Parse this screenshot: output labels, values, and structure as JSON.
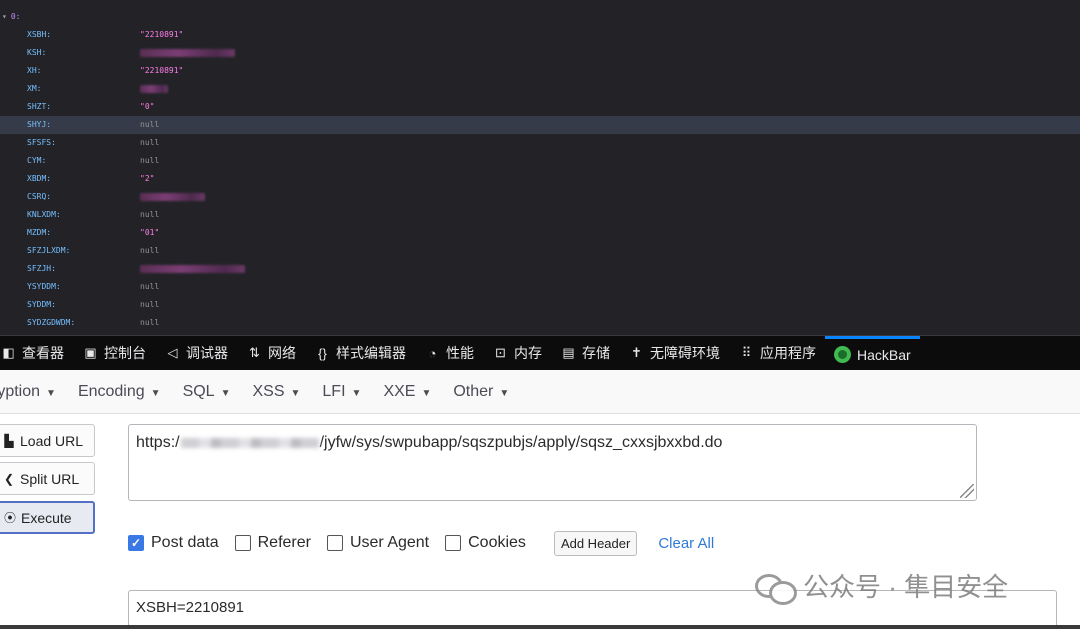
{
  "json_viewer": {
    "root_key": "0:",
    "rows": [
      {
        "key": "XSBH:",
        "value": "\"2210891\"",
        "type": "str"
      },
      {
        "key": "KSH:",
        "value": "",
        "type": "redacted"
      },
      {
        "key": "XH:",
        "value": "\"2210891\"",
        "type": "str"
      },
      {
        "key": "XM:",
        "value": "",
        "type": "redacted"
      },
      {
        "key": "SHZT:",
        "value": "\"0\"",
        "type": "str"
      },
      {
        "key": "SHYJ:",
        "value": "null",
        "type": "null",
        "selected": true
      },
      {
        "key": "SFSFS:",
        "value": "null",
        "type": "null"
      },
      {
        "key": "CYM:",
        "value": "null",
        "type": "null"
      },
      {
        "key": "XBDM:",
        "value": "\"2\"",
        "type": "str"
      },
      {
        "key": "CSRQ:",
        "value": "",
        "type": "redacted"
      },
      {
        "key": "KNLXDM:",
        "value": "null",
        "type": "null"
      },
      {
        "key": "MZDM:",
        "value": "\"01\"",
        "type": "str"
      },
      {
        "key": "SFZJLXDM:",
        "value": "null",
        "type": "null"
      },
      {
        "key": "SFZJH:",
        "value": "",
        "type": "redacted"
      },
      {
        "key": "YSYDDM:",
        "value": "null",
        "type": "null"
      },
      {
        "key": "SYDDM:",
        "value": "null",
        "type": "null"
      },
      {
        "key": "SYDZGDWDM:",
        "value": "null",
        "type": "null"
      }
    ]
  },
  "devtools_tabs": [
    {
      "label": "查看器",
      "icon": "inspector-icon"
    },
    {
      "label": "控制台",
      "icon": "console-icon"
    },
    {
      "label": "调试器",
      "icon": "debugger-icon"
    },
    {
      "label": "网络",
      "icon": "network-icon"
    },
    {
      "label": "样式编辑器",
      "icon": "style-editor-icon"
    },
    {
      "label": "性能",
      "icon": "performance-icon"
    },
    {
      "label": "内存",
      "icon": "memory-icon"
    },
    {
      "label": "存储",
      "icon": "storage-icon"
    },
    {
      "label": "无障碍环境",
      "icon": "accessibility-icon"
    },
    {
      "label": "应用程序",
      "icon": "application-icon"
    },
    {
      "label": "HackBar",
      "icon": "hackbar-icon",
      "active": true
    }
  ],
  "hackbar_menu": [
    "ryption",
    "Encoding",
    "SQL",
    "XSS",
    "LFI",
    "XXE",
    "Other"
  ],
  "buttons": {
    "load_url": "Load URL",
    "split_url": "Split URL",
    "execute": "Execute"
  },
  "url": {
    "scheme": "https:/",
    "path": "/jyfw/sys/swpubapp/sqszpubjs/apply/sqsz_cxxsjbxxbd.do"
  },
  "options": {
    "post_data": {
      "label": "Post data",
      "checked": true
    },
    "referer": {
      "label": "Referer",
      "checked": false
    },
    "user_agent": {
      "label": "User Agent",
      "checked": false
    },
    "cookies": {
      "label": "Cookies",
      "checked": false
    },
    "add_header": "Add Header",
    "clear_all": "Clear All"
  },
  "post_body": "XSBH=2210891",
  "watermark": "公众号 · 隼目安全",
  "colors": {
    "json_bg": "#232327",
    "json_key": "#75bfff",
    "json_string": "#ff7de9",
    "json_null": "#939395",
    "tab_active": "#0a84ff",
    "checkbox_checked": "#3a78e6",
    "link": "#2f7ad6"
  }
}
